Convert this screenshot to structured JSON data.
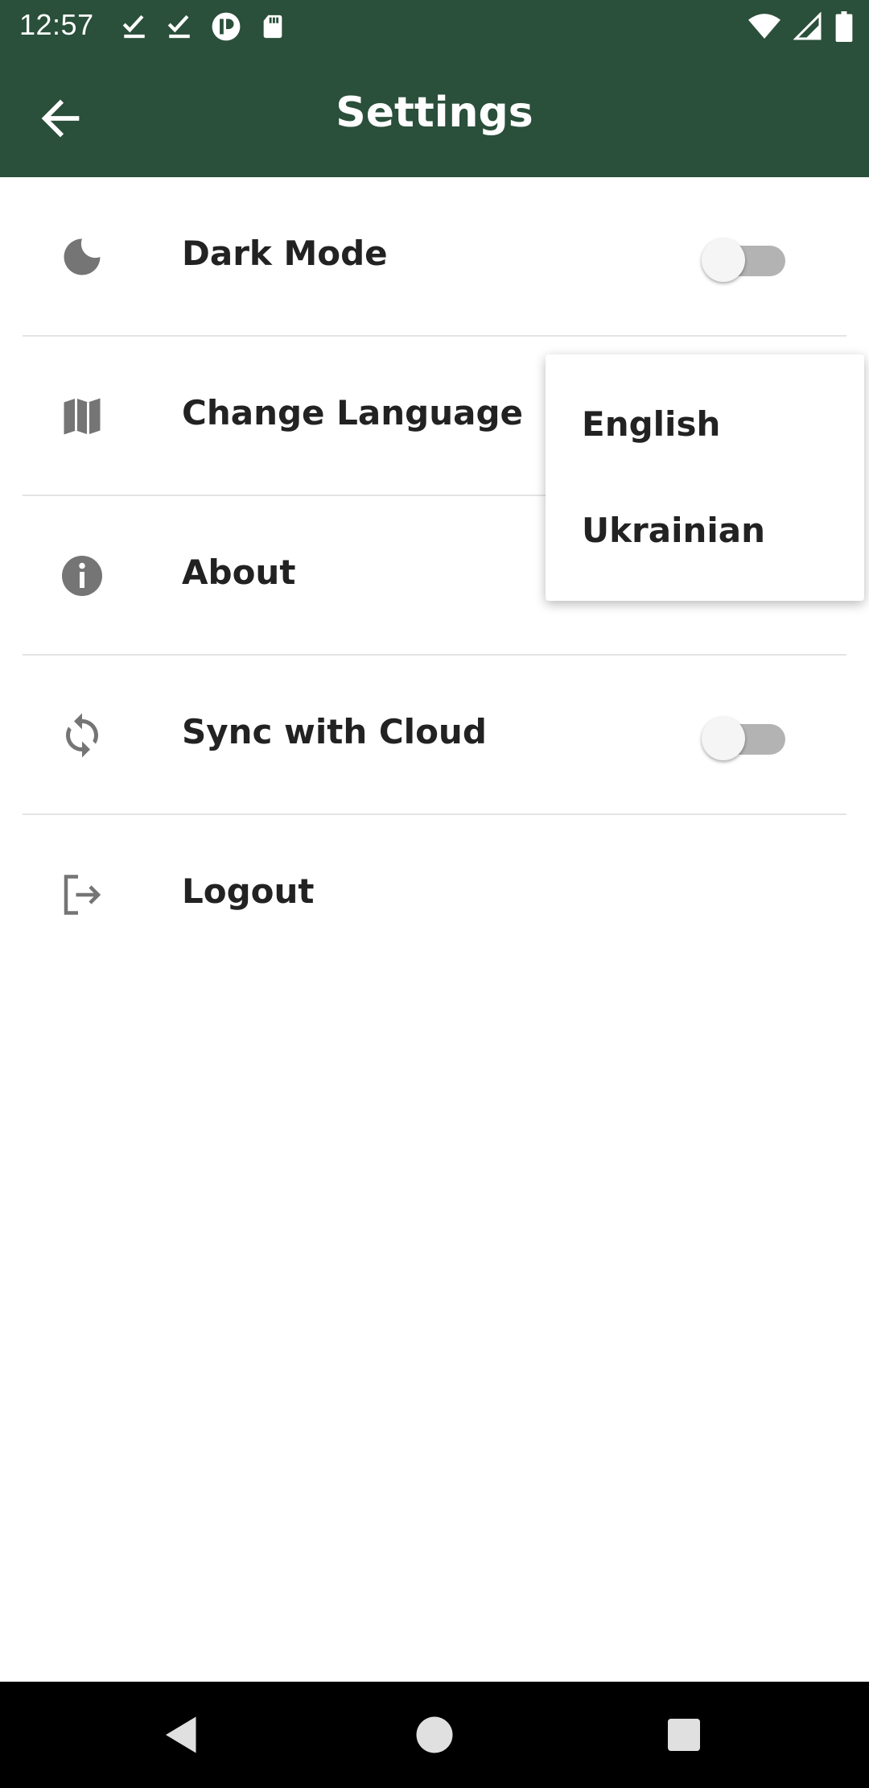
{
  "status_bar": {
    "time": "12:57",
    "left_icons": [
      "download-done-icon",
      "download-done-icon",
      "app-notification-icon",
      "sd-card-icon"
    ],
    "right_icons": [
      "wifi-icon",
      "cellular-signal-icon",
      "battery-icon"
    ]
  },
  "app_bar": {
    "title": "Settings",
    "back_icon": "arrow-back-icon",
    "background_color": "#2a4f3a"
  },
  "settings": {
    "items": [
      {
        "label": "Dark Mode",
        "icon": "moon-icon",
        "has_toggle": true,
        "toggle_on": false
      },
      {
        "label": "Change Language",
        "icon": "map-icon",
        "has_toggle": false
      },
      {
        "label": "About",
        "icon": "info-icon",
        "has_toggle": false
      },
      {
        "label": "Sync with Cloud",
        "icon": "sync-icon",
        "has_toggle": true,
        "toggle_on": false
      },
      {
        "label": "Logout",
        "icon": "logout-icon",
        "has_toggle": false
      }
    ]
  },
  "language_menu": {
    "options": [
      "English",
      "Ukrainian"
    ]
  },
  "nav_bar": {
    "buttons": [
      "back-triangle-icon",
      "home-circle-icon",
      "recents-square-icon"
    ]
  }
}
